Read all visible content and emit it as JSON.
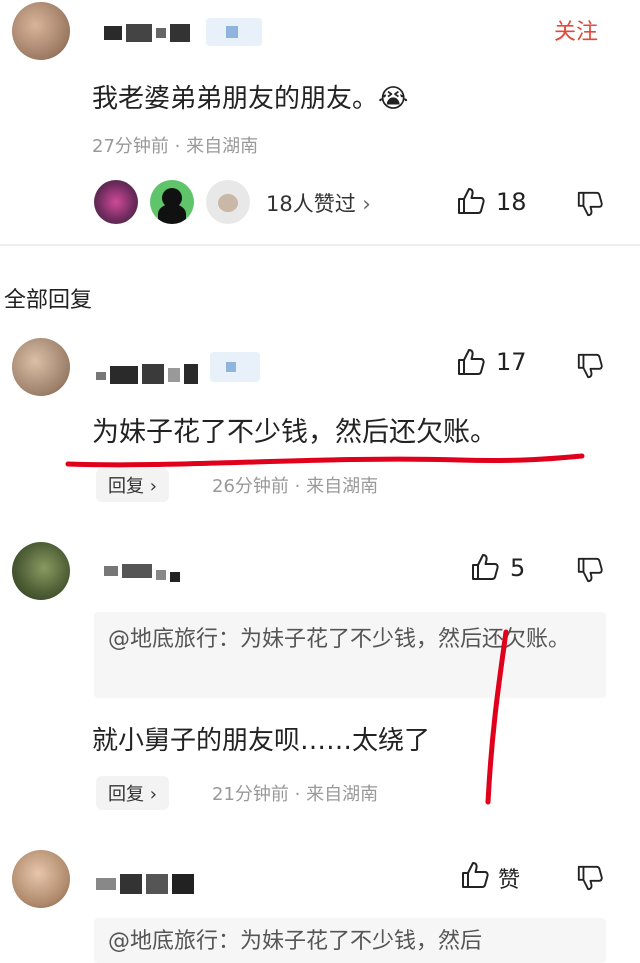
{
  "main_comment": {
    "follow_label": "关注",
    "text": "我老婆弟弟朋友的朋友。",
    "emoji": "😭",
    "meta": "27分钟前 · 来自湖南",
    "likers_label": "18人赞过",
    "likers_chevron": "›",
    "like_count": "18"
  },
  "section_title": "全部回复",
  "replies": [
    {
      "text": "为妹子花了不少钱，然后还欠账。",
      "like_count": "17",
      "reply_label": "回复",
      "reply_chevron": "›",
      "meta": "26分钟前 · 来自湖南"
    },
    {
      "quote": "@地底旅行：为妹子花了不少钱，然后还欠账。",
      "text": "就小舅子的朋友呗……太绕了",
      "like_count": "5",
      "reply_label": "回复",
      "reply_chevron": "›",
      "meta": "21分钟前 · 来自湖南"
    },
    {
      "quote": "@地底旅行：为妹子花了不少钱，然后",
      "like_label": "赞"
    }
  ],
  "colors": {
    "follow": "#e04a3a",
    "annotation": "#e0001c",
    "meta": "#999999",
    "quote_bg": "#f6f6f6"
  }
}
